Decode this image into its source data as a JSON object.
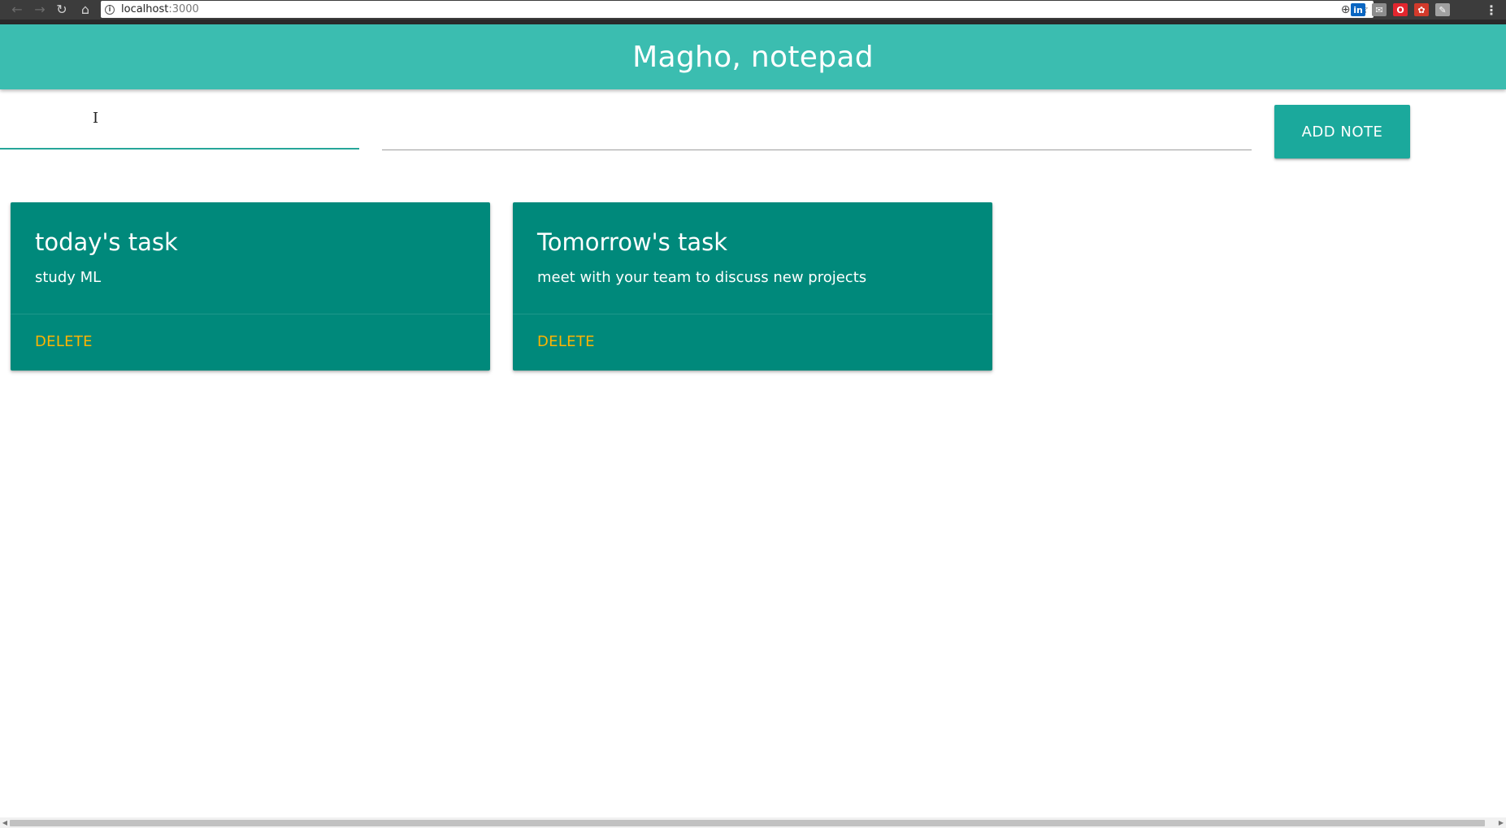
{
  "browser": {
    "back_icon": "←",
    "forward_icon": "→",
    "reload_icon": "↻",
    "home_icon": "⌂",
    "info_icon": "i",
    "url_host": "localhost",
    "url_port": ":3000",
    "zoom_icon": "⊕",
    "star_icon": "☆",
    "extensions": [
      {
        "name": "linkedin-extension-icon",
        "glyph": "in",
        "color": "#0a66c2"
      },
      {
        "name": "mail-extension-icon",
        "glyph": "✉",
        "color": "#8c8c8c"
      },
      {
        "name": "opera-extension-icon",
        "glyph": "O",
        "color": "#e3262e"
      },
      {
        "name": "red-extension-icon",
        "glyph": "✿",
        "color": "#d23a2b"
      },
      {
        "name": "gray-extension-icon",
        "glyph": "✎",
        "color": "#a0a0a0"
      }
    ],
    "menu_icon": "⋮"
  },
  "header": {
    "title": "Magho, notepad",
    "color": "#3bbdb0"
  },
  "form": {
    "title_value": "",
    "content_value": "",
    "cursor_glyph": "I",
    "add_button_label": "ADD NOTE"
  },
  "notes": [
    {
      "title": "today's task",
      "content": "study ML",
      "action": "DELETE"
    },
    {
      "title": "Tomorrow's task",
      "content": "meet with your team to discuss new projects",
      "action": "DELETE"
    }
  ],
  "colors": {
    "card": "#00897b",
    "accent": "#26a69a",
    "delete": "#ffb300"
  }
}
